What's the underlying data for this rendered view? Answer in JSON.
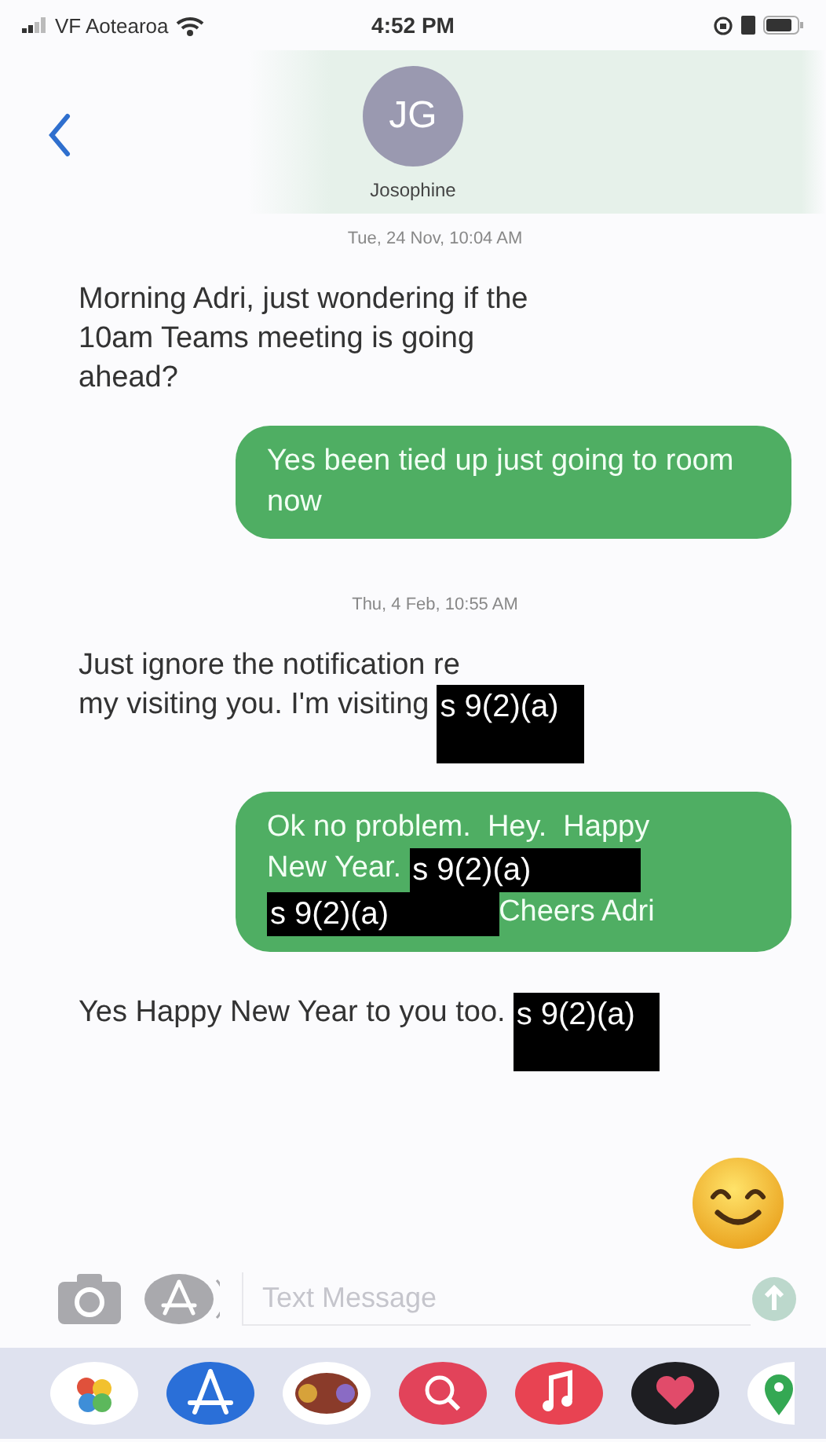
{
  "status_bar": {
    "carrier": "VF Aotearoa",
    "time": "4:52 PM"
  },
  "contact": {
    "initials": "JG",
    "name": "Josophine"
  },
  "thread": [
    {
      "kind": "timestamp",
      "text": "Tue, 24 Nov, 10:04 AM"
    },
    {
      "kind": "incoming",
      "segments": [
        {
          "kind": "text",
          "text": "Morning Adri, just wondering if the 10am Teams meeting is going ahead?"
        }
      ]
    },
    {
      "kind": "outgoing",
      "segments": [
        {
          "kind": "text",
          "text": "Yes been tied up just going to room now"
        }
      ]
    },
    {
      "kind": "timestamp",
      "text": "Thu, 4 Feb, 10:55 AM"
    },
    {
      "kind": "incoming",
      "segments": [
        {
          "kind": "text",
          "text": "Just ignore the notification re"
        },
        {
          "kind": "text",
          "text": "my visiting you. I'm visiting"
        },
        {
          "kind": "redaction",
          "text": "s 9(2)(a)"
        }
      ]
    },
    {
      "kind": "outgoing",
      "segments": [
        {
          "kind": "text",
          "text": "Ok no problem.  Hey.  Happy"
        },
        {
          "kind": "text",
          "text": "New Year."
        },
        {
          "kind": "redaction",
          "text": "s 9(2)(a)"
        },
        {
          "kind": "redaction",
          "text": "s 9(2)(a)"
        },
        {
          "kind": "text",
          "text": "Cheers Adri"
        }
      ]
    },
    {
      "kind": "incoming",
      "segments": [
        {
          "kind": "text",
          "text": "Yes Happy New Year to you too."
        },
        {
          "kind": "redaction",
          "text": "s 9(2)(a)"
        }
      ]
    }
  ],
  "composer": {
    "placeholder": "Text Message"
  }
}
